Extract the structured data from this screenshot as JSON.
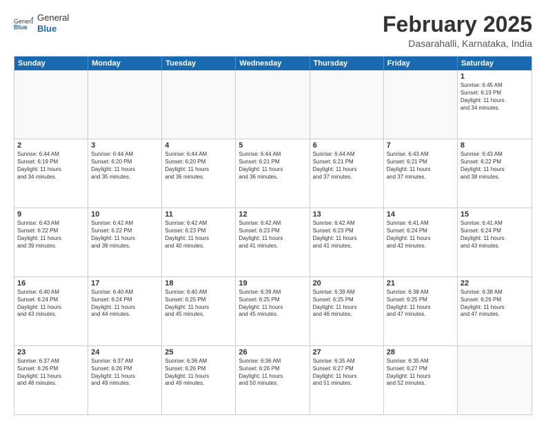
{
  "logo": {
    "text_general": "General",
    "text_blue": "Blue"
  },
  "header": {
    "title": "February 2025",
    "subtitle": "Dasarahalli, Karnataka, India"
  },
  "weekdays": [
    "Sunday",
    "Monday",
    "Tuesday",
    "Wednesday",
    "Thursday",
    "Friday",
    "Saturday"
  ],
  "weeks": [
    [
      {
        "day": "",
        "text": ""
      },
      {
        "day": "",
        "text": ""
      },
      {
        "day": "",
        "text": ""
      },
      {
        "day": "",
        "text": ""
      },
      {
        "day": "",
        "text": ""
      },
      {
        "day": "",
        "text": ""
      },
      {
        "day": "1",
        "text": "Sunrise: 6:45 AM\nSunset: 6:19 PM\nDaylight: 11 hours\nand 34 minutes."
      }
    ],
    [
      {
        "day": "2",
        "text": "Sunrise: 6:44 AM\nSunset: 6:19 PM\nDaylight: 11 hours\nand 34 minutes."
      },
      {
        "day": "3",
        "text": "Sunrise: 6:44 AM\nSunset: 6:20 PM\nDaylight: 11 hours\nand 35 minutes."
      },
      {
        "day": "4",
        "text": "Sunrise: 6:44 AM\nSunset: 6:20 PM\nDaylight: 11 hours\nand 36 minutes."
      },
      {
        "day": "5",
        "text": "Sunrise: 6:44 AM\nSunset: 6:21 PM\nDaylight: 11 hours\nand 36 minutes."
      },
      {
        "day": "6",
        "text": "Sunrise: 6:44 AM\nSunset: 6:21 PM\nDaylight: 11 hours\nand 37 minutes."
      },
      {
        "day": "7",
        "text": "Sunrise: 6:43 AM\nSunset: 6:21 PM\nDaylight: 11 hours\nand 37 minutes."
      },
      {
        "day": "8",
        "text": "Sunrise: 6:43 AM\nSunset: 6:22 PM\nDaylight: 11 hours\nand 38 minutes."
      }
    ],
    [
      {
        "day": "9",
        "text": "Sunrise: 6:43 AM\nSunset: 6:22 PM\nDaylight: 11 hours\nand 39 minutes."
      },
      {
        "day": "10",
        "text": "Sunrise: 6:42 AM\nSunset: 6:22 PM\nDaylight: 11 hours\nand 39 minutes."
      },
      {
        "day": "11",
        "text": "Sunrise: 6:42 AM\nSunset: 6:23 PM\nDaylight: 11 hours\nand 40 minutes."
      },
      {
        "day": "12",
        "text": "Sunrise: 6:42 AM\nSunset: 6:23 PM\nDaylight: 11 hours\nand 41 minutes."
      },
      {
        "day": "13",
        "text": "Sunrise: 6:42 AM\nSunset: 6:23 PM\nDaylight: 11 hours\nand 41 minutes."
      },
      {
        "day": "14",
        "text": "Sunrise: 6:41 AM\nSunset: 6:24 PM\nDaylight: 11 hours\nand 42 minutes."
      },
      {
        "day": "15",
        "text": "Sunrise: 6:41 AM\nSunset: 6:24 PM\nDaylight: 11 hours\nand 43 minutes."
      }
    ],
    [
      {
        "day": "16",
        "text": "Sunrise: 6:40 AM\nSunset: 6:24 PM\nDaylight: 11 hours\nand 43 minutes."
      },
      {
        "day": "17",
        "text": "Sunrise: 6:40 AM\nSunset: 6:24 PM\nDaylight: 11 hours\nand 44 minutes."
      },
      {
        "day": "18",
        "text": "Sunrise: 6:40 AM\nSunset: 6:25 PM\nDaylight: 11 hours\nand 45 minutes."
      },
      {
        "day": "19",
        "text": "Sunrise: 6:39 AM\nSunset: 6:25 PM\nDaylight: 11 hours\nand 45 minutes."
      },
      {
        "day": "20",
        "text": "Sunrise: 6:39 AM\nSunset: 6:25 PM\nDaylight: 11 hours\nand 46 minutes."
      },
      {
        "day": "21",
        "text": "Sunrise: 6:38 AM\nSunset: 6:25 PM\nDaylight: 11 hours\nand 47 minutes."
      },
      {
        "day": "22",
        "text": "Sunrise: 6:38 AM\nSunset: 6:26 PM\nDaylight: 11 hours\nand 47 minutes."
      }
    ],
    [
      {
        "day": "23",
        "text": "Sunrise: 6:37 AM\nSunset: 6:26 PM\nDaylight: 11 hours\nand 48 minutes."
      },
      {
        "day": "24",
        "text": "Sunrise: 6:37 AM\nSunset: 6:26 PM\nDaylight: 11 hours\nand 49 minutes."
      },
      {
        "day": "25",
        "text": "Sunrise: 6:36 AM\nSunset: 6:26 PM\nDaylight: 11 hours\nand 49 minutes."
      },
      {
        "day": "26",
        "text": "Sunrise: 6:36 AM\nSunset: 6:26 PM\nDaylight: 11 hours\nand 50 minutes."
      },
      {
        "day": "27",
        "text": "Sunrise: 6:35 AM\nSunset: 6:27 PM\nDaylight: 11 hours\nand 51 minutes."
      },
      {
        "day": "28",
        "text": "Sunrise: 6:35 AM\nSunset: 6:27 PM\nDaylight: 11 hours\nand 52 minutes."
      },
      {
        "day": "",
        "text": ""
      }
    ]
  ]
}
